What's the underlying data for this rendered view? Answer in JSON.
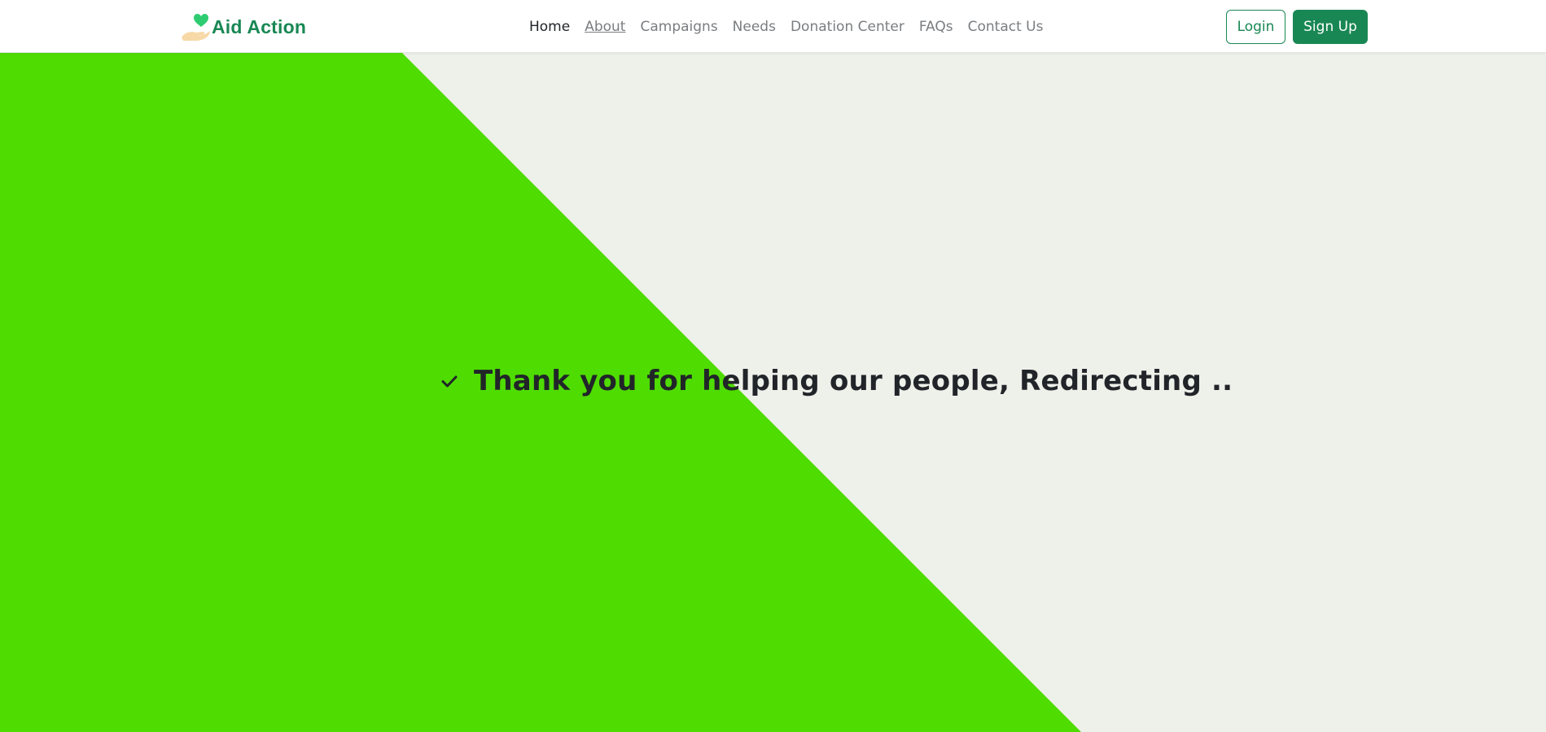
{
  "brand": {
    "name": "Aid Action",
    "logo_icon": "heart-hand-icon",
    "color": "#198754",
    "heart_color": "#2ecc71",
    "hand_color": "#f7d9a8"
  },
  "nav": {
    "items": [
      {
        "label": "Home",
        "active": true
      },
      {
        "label": "About",
        "active": false
      },
      {
        "label": "Campaigns",
        "active": false
      },
      {
        "label": "Needs",
        "active": false
      },
      {
        "label": "Donation Center",
        "active": false
      },
      {
        "label": "FAQs",
        "active": false
      },
      {
        "label": "Contact Us",
        "active": false
      }
    ]
  },
  "auth": {
    "login_label": "Login",
    "signup_label": "Sign Up",
    "accent_color": "#198754"
  },
  "hero": {
    "message": "Thank you for helping our people, Redirecting ..",
    "status_icon": "check-icon",
    "background_color": "#eef0ea",
    "diagonal_color": "#4fdc00"
  }
}
